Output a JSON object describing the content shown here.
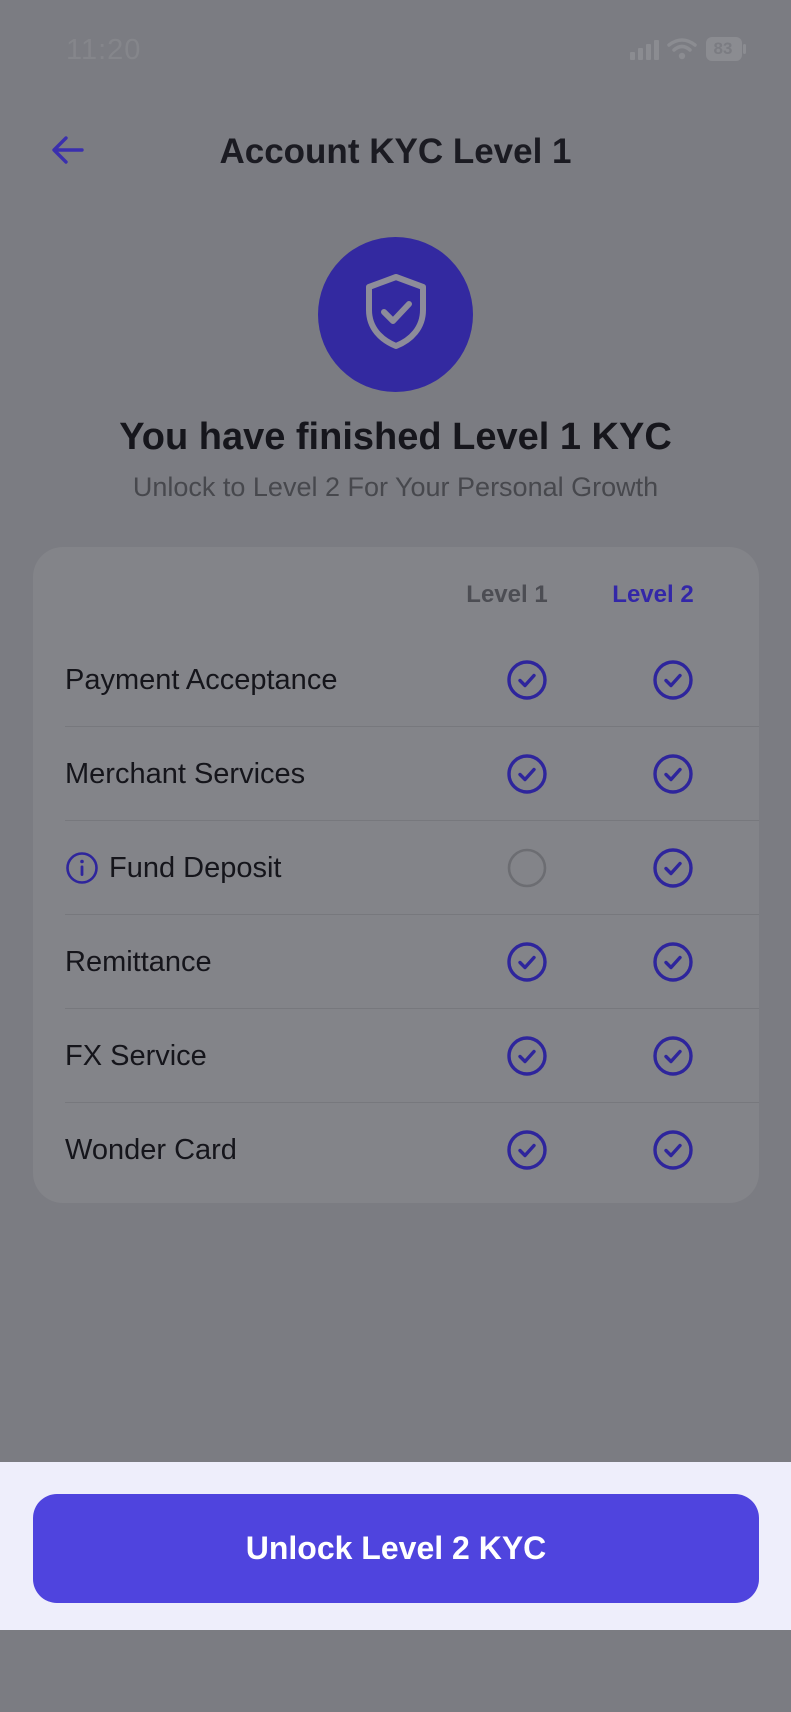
{
  "status_bar": {
    "time": "11:20",
    "battery": "83"
  },
  "header": {
    "back_icon": "arrow-left-icon",
    "title": "Account KYC Level 1"
  },
  "badge": {
    "icon": "shield-check-icon",
    "color": "#3329a0"
  },
  "headline": "You have finished Level 1 KYC",
  "subheadline": "Unlock to Level 2 For Your Personal Growth",
  "table": {
    "columns": [
      "Level 1",
      "Level 2"
    ],
    "rows": [
      {
        "label": "Payment Acceptance",
        "level1": true,
        "level2": true,
        "info": false
      },
      {
        "label": "Merchant Services",
        "level1": true,
        "level2": true,
        "info": false
      },
      {
        "label": "Fund Deposit",
        "level1": false,
        "level2": true,
        "info": true
      },
      {
        "label": "Remittance",
        "level1": true,
        "level2": true,
        "info": false
      },
      {
        "label": "FX Service",
        "level1": true,
        "level2": true,
        "info": false
      },
      {
        "label": "Wonder Card",
        "level1": true,
        "level2": true,
        "info": false
      }
    ]
  },
  "action": {
    "label": "Unlock Level 2 KYC",
    "color": "#4f44de"
  },
  "colors": {
    "accent": "#3327a8",
    "overlay": "#7b7c82"
  }
}
